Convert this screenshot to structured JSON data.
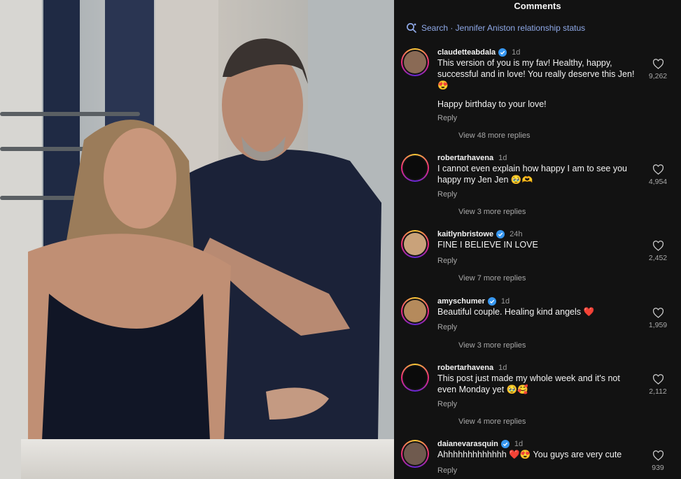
{
  "header": {
    "title": "Comments"
  },
  "search": {
    "label": "Search · Jennifer Aniston relationship status"
  },
  "comments": [
    {
      "username": "claudetteabdala",
      "verified": true,
      "time": "1d",
      "text_lines": [
        "This version of you is my fav! Healthy, happy, successful and in love! You really deserve this Jen! 😍",
        "Happy birthday to your love!"
      ],
      "reply_label": "Reply",
      "view_replies": "View 48 more replies",
      "likes": "9,262",
      "avatar_color": "#8a6a55"
    },
    {
      "username": "robertarhavena",
      "verified": false,
      "time": "1d",
      "text_lines": [
        "I cannot even explain how happy I am to see you happy my Jen Jen 🥹🫶"
      ],
      "reply_label": "Reply",
      "view_replies": "View 3 more replies",
      "likes": "4,954",
      "avatar_color": "#0b0b0b"
    },
    {
      "username": "kaitlynbristowe",
      "verified": true,
      "time": "24h",
      "text_lines": [
        "FINE I BELIEVE IN LOVE"
      ],
      "reply_label": "Reply",
      "view_replies": "View 7 more replies",
      "likes": "2,452",
      "avatar_color": "#c9a27a"
    },
    {
      "username": "amyschumer",
      "verified": true,
      "time": "1d",
      "text_lines": [
        "Beautiful couple. Healing  kind angels ❤️"
      ],
      "reply_label": "Reply",
      "view_replies": "View 3 more replies",
      "likes": "1,959",
      "avatar_color": "#b58a5c"
    },
    {
      "username": "robertarhavena",
      "verified": false,
      "time": "1d",
      "text_lines": [
        "This post just made my whole week and it's not even Monday yet 🥹🥰"
      ],
      "reply_label": "Reply",
      "view_replies": "View 4 more replies",
      "likes": "2,112",
      "avatar_color": "#0b0b0b"
    },
    {
      "username": "daianevarasquin",
      "verified": true,
      "time": "1d",
      "text_lines": [
        "Ahhhhhhhhhhhhh ❤️😍 You guys are very cute"
      ],
      "reply_label": "Reply",
      "view_replies": "",
      "likes": "939",
      "avatar_color": "#6f5a4e"
    }
  ],
  "colors": {
    "panel_bg": "#121212",
    "search_accent": "#8fa9e8",
    "verified": "#3797f0"
  }
}
